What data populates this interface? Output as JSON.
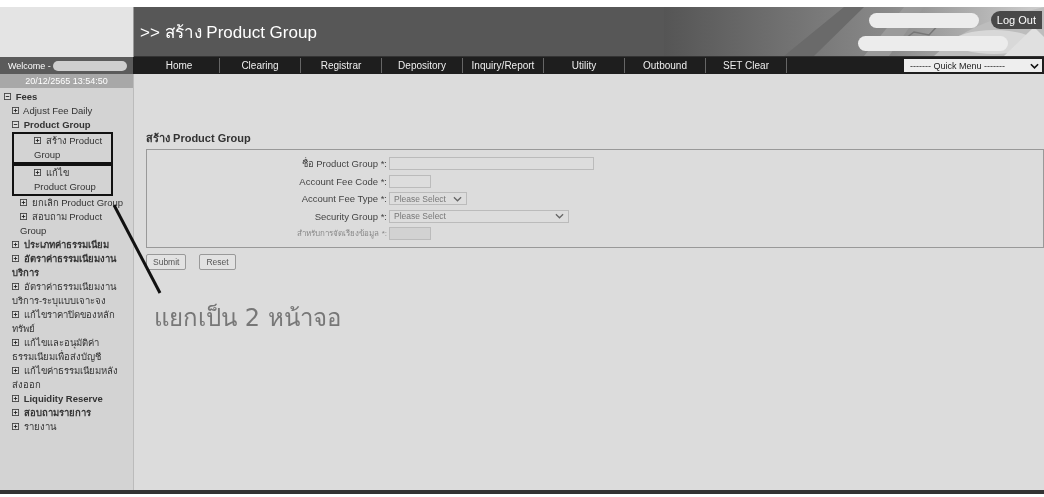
{
  "header": {
    "title": ">> สร้าง Product Group",
    "logout": "Log Out"
  },
  "nav": {
    "items": [
      "Home",
      "Clearing",
      "Registrar",
      "Depository",
      "Inquiry/Report",
      "Utility",
      "Outbound",
      "SET Clear"
    ],
    "quick_menu": "------- Quick Menu -------"
  },
  "sidebar": {
    "welcome": "Welcome -",
    "datetime": "20/12/2565 13:54:50",
    "items": [
      {
        "label": "Fees",
        "bold": true,
        "expanded": true,
        "children": [
          {
            "label": "Adjust Fee Daily",
            "bold": false,
            "expanded": false
          },
          {
            "label": "Product Group",
            "bold": true,
            "expanded": true,
            "children": [
              {
                "label": "สร้าง Product Group",
                "bold": false,
                "expanded": false,
                "highlighted": true
              },
              {
                "label": "แก้ไข Product Group",
                "bold": false,
                "expanded": false,
                "highlighted": true
              },
              {
                "label": "ยกเลิก Product Group",
                "bold": false,
                "expanded": false,
                "highlighted": false
              },
              {
                "label": "สอบถาม Product Group",
                "bold": false,
                "expanded": false,
                "highlighted": false
              }
            ]
          },
          {
            "label": "ประเภทค่าธรรมเนียม",
            "bold": true,
            "expanded": false
          },
          {
            "label": "อัตราค่าธรรมเนียมงานบริการ",
            "bold": true,
            "expanded": false
          },
          {
            "label": "อัตราค่าธรรมเนียมงานบริการ-ระบุแบบเจาะจง",
            "bold": false,
            "expanded": false
          },
          {
            "label": "แก้ไขราคาปิดของหลักทรัพย์",
            "bold": false,
            "expanded": false
          },
          {
            "label": "แก้ไขและอนุมัติค่าธรรมเนียมเพื่อส่งบัญชี",
            "bold": false,
            "expanded": false
          },
          {
            "label": "แก้ไขค่าธรรมเนียมหลังส่งออก",
            "bold": false,
            "expanded": false
          },
          {
            "label": "Liquidity Reserve",
            "bold": true,
            "expanded": false
          },
          {
            "label": "สอบถามรายการ",
            "bold": true,
            "expanded": false
          },
          {
            "label": "รายงาน",
            "bold": false,
            "expanded": false
          }
        ]
      }
    ]
  },
  "form": {
    "title": "สร้าง Product Group",
    "fields": [
      {
        "kind": "text",
        "label": "ชื่อ Product Group *:",
        "disabled": false
      },
      {
        "kind": "text",
        "label": "Account Fee Code *:",
        "disabled": false
      },
      {
        "kind": "select",
        "label": "Account Fee Type *:",
        "value": "Please Select",
        "disabled": false
      },
      {
        "kind": "select",
        "label": "Security Group *:",
        "value": "Please Select",
        "disabled": false
      },
      {
        "kind": "text",
        "label": "สำหรับการจัดเรียงข้อมูล *:",
        "disabled": true
      }
    ],
    "buttons": [
      "Submit",
      "Reset"
    ]
  },
  "annotation": {
    "text": "แยกเป็น 2 หน้าจอ"
  }
}
